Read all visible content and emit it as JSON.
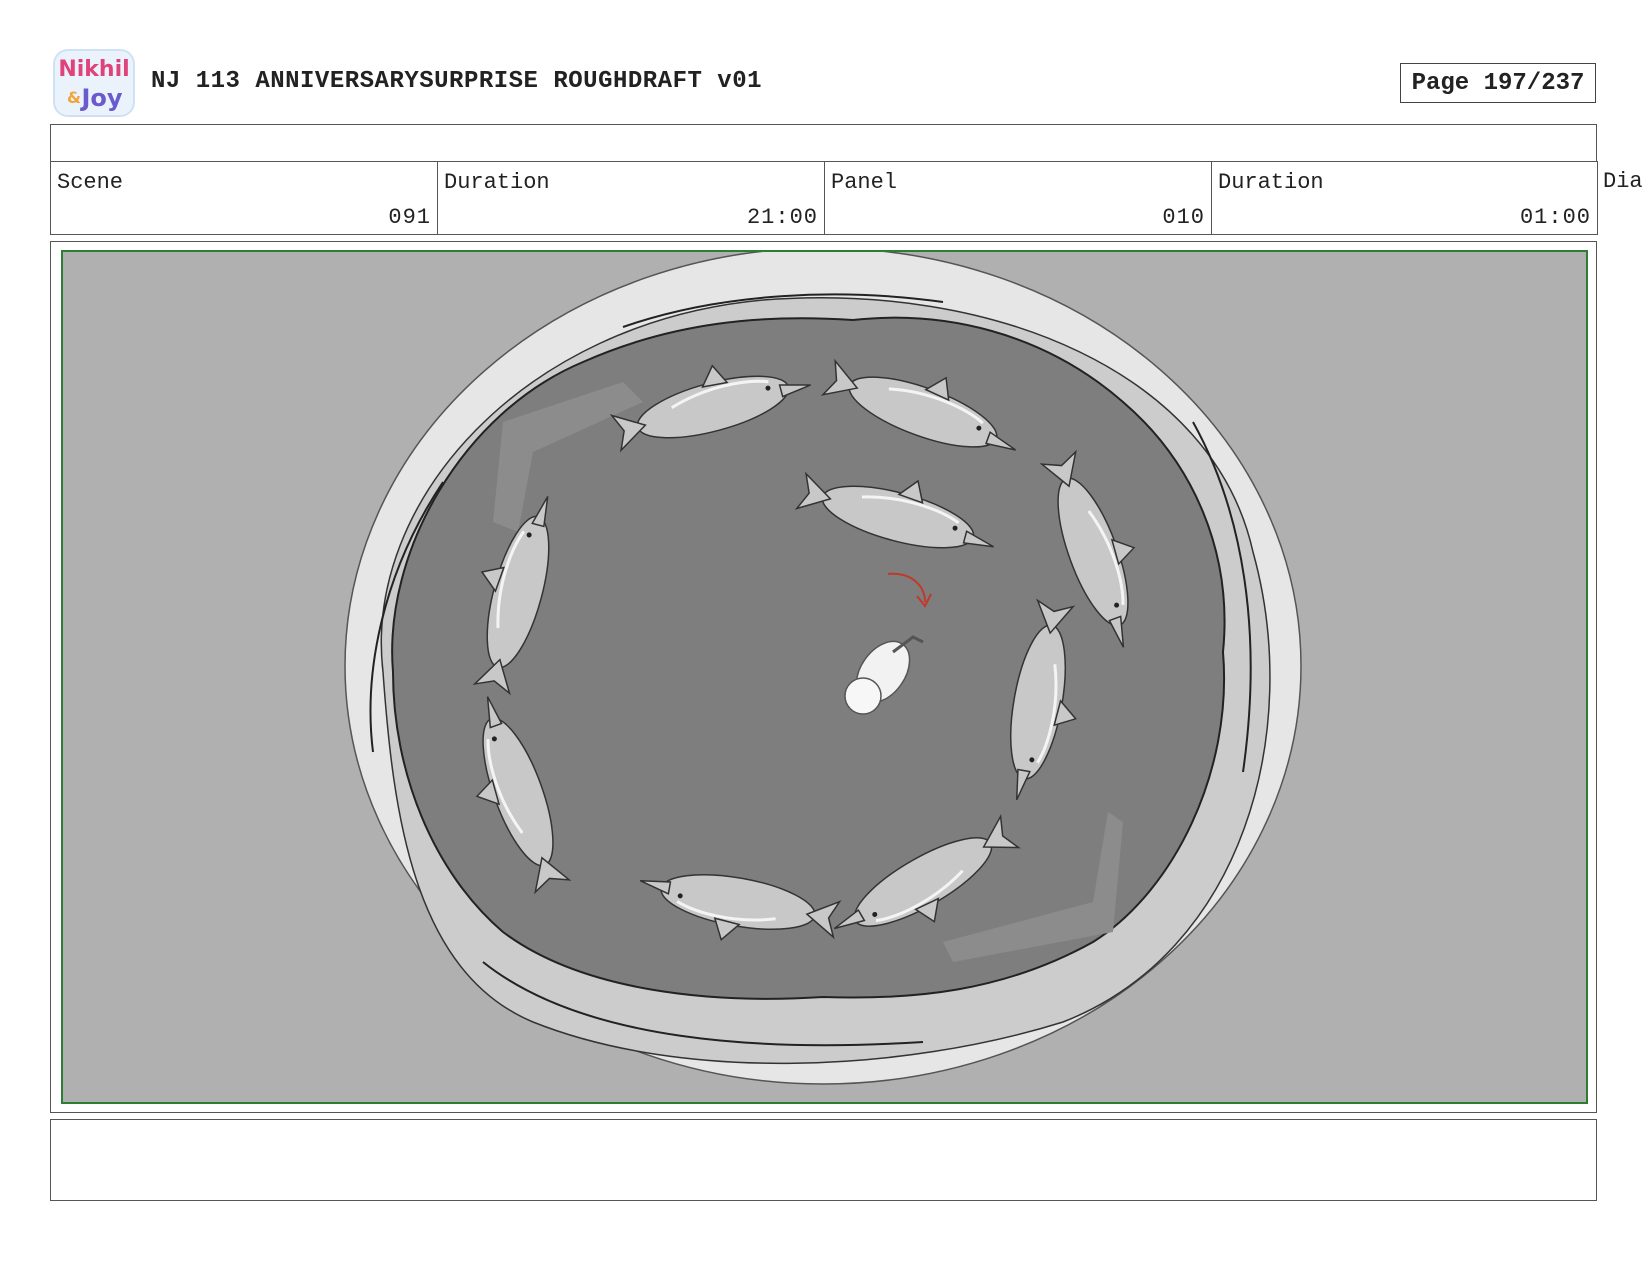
{
  "header": {
    "logo_text": [
      "Nikhil",
      "&",
      "Joy"
    ],
    "title": "NJ 113 ANNIVERSARYSURPRISE ROUGHDRAFT v01",
    "page_label": "Page 197/237"
  },
  "info": {
    "scene_label": "Scene",
    "scene_value": "091",
    "scene_duration_label": "Duration",
    "scene_duration_value": "21:00",
    "panel_label": "Panel",
    "panel_value": "010",
    "panel_duration_label": "Duration",
    "panel_duration_value": "01:00",
    "dialogue_label": "Dia"
  },
  "panel": {
    "colors": {
      "background": "#b0b0b0",
      "rim": "#e6e6e6",
      "pool_ring": "#cfcfcf",
      "water": "#7e7e7e",
      "frame": "#2e7d32",
      "arrow": "#c0392b"
    },
    "dolphin_count": 9
  },
  "notes": {
    "text": ""
  }
}
